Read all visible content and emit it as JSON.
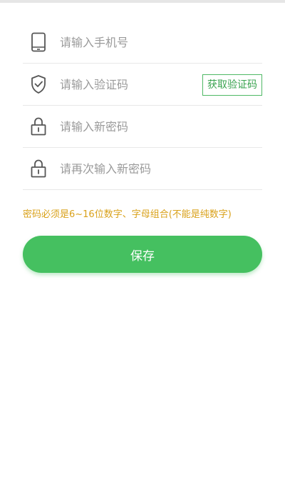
{
  "form": {
    "phone": {
      "placeholder": "请输入手机号",
      "value": "",
      "icon": "phone-icon"
    },
    "code": {
      "placeholder": "请输入验证码",
      "value": "",
      "icon": "shield-check-icon",
      "button_label": "获取验证码"
    },
    "new_password": {
      "placeholder": "请输入新密码",
      "value": "",
      "icon": "lock-icon"
    },
    "confirm_password": {
      "placeholder": "请再次输入新密码",
      "value": "",
      "icon": "lock-icon"
    }
  },
  "hint": "密码必须是6~16位数字、字母组合(不能是纯数字)",
  "save_label": "保存",
  "colors": {
    "accent": "#45c060",
    "hint": "#d9a11a",
    "icon": "#555555",
    "divider": "#e8e8e8"
  }
}
